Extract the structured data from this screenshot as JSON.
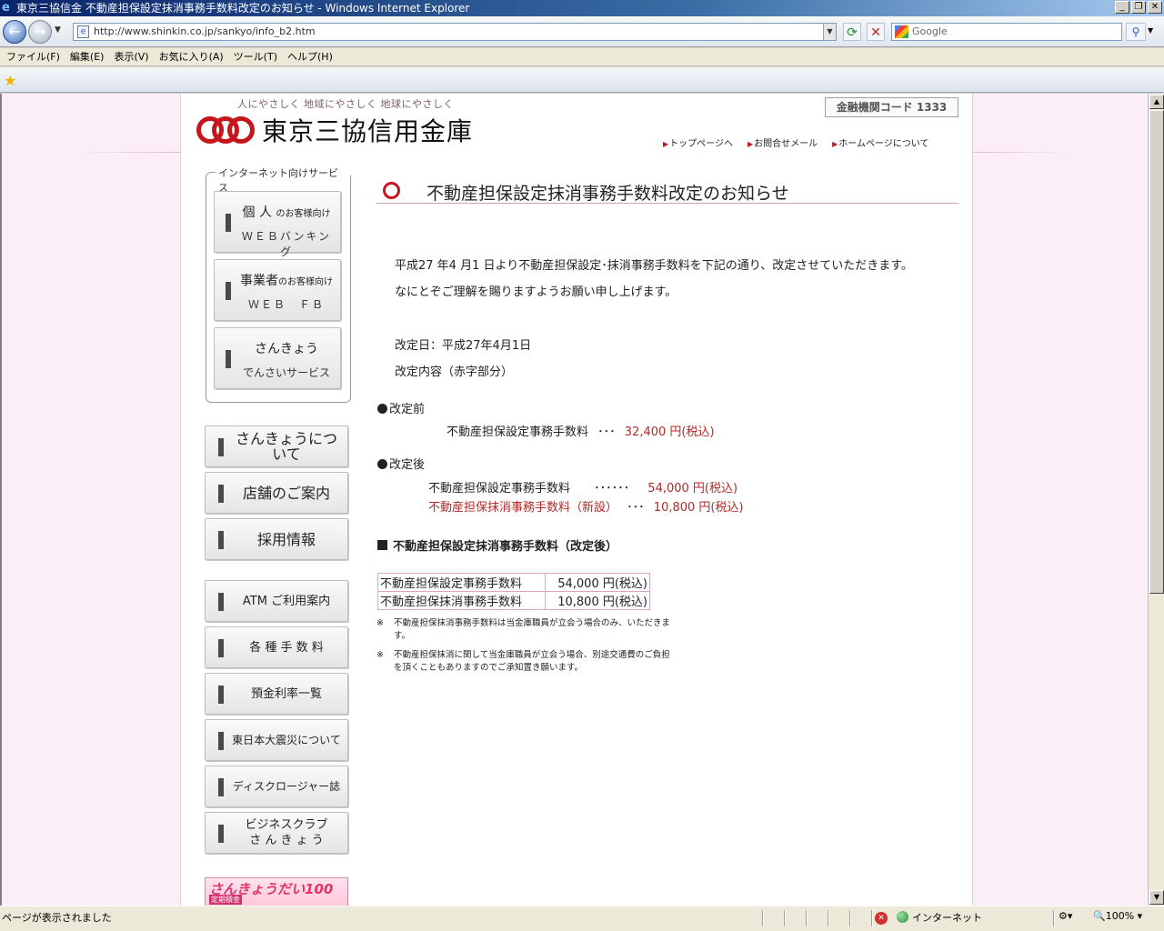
{
  "browser": {
    "title": "東京三協信金 不動産担保設定抹消事務手数料改定のお知らせ - Windows Internet Explorer",
    "url": "http://www.shinkin.co.jp/sankyo/info_b2.htm",
    "search_placeholder": "Google",
    "menu": [
      "ファイル(F)",
      "編集(E)",
      "表示(V)",
      "お気に入り(A)",
      "ツール(T)",
      "ヘルプ(H)"
    ],
    "status_message": "ページが表示されました",
    "zone": "インターネット",
    "zoom": "100%"
  },
  "header": {
    "tagline": "人にやさしく 地域にやさしく 地球にやさしく",
    "bank_name": "東京三協信用金庫",
    "institution_code": "金融機関コード 1333",
    "links": [
      "トップページへ",
      "お問合せメール",
      "ホームページについて"
    ]
  },
  "sidebar": {
    "service_legend": "インターネット向けサービス",
    "services": [
      {
        "line1": "個 人",
        "line1_small": "のお客様向け",
        "line2": "ＷＥＢバンキング"
      },
      {
        "line1": "事業者",
        "line1_small": "のお客様向け",
        "line2": "ＷＥＢ　ＦＢ"
      },
      {
        "line1": "さんきょう",
        "line1_small": "",
        "line2": "でんさいサービス"
      }
    ],
    "nav": [
      "さんきょうについて",
      "店舗のご案内",
      "採用情報",
      "ATM ご利用案内",
      "各 種 手 数 料",
      "預金利率一覧",
      "東日本大震災について",
      "ディスクロージャー誌",
      "ビジネスクラブ\nさ ん き ょ う"
    ],
    "banner_text": "さんきょうだい100",
    "banner_sub": "定期積金"
  },
  "main": {
    "title": "不動産担保設定抹消事務手数料改定のお知らせ",
    "intro1": "平成27 年4 月1 日より不動産担保設定･抹消事務手数料を下記の通り、改定させていただきます。",
    "intro2": "なにとぞご理解を賜りますようお願い申し上げます。",
    "revision_date": "改定日：平成27年4月1日",
    "revision_content": "改定内容（赤字部分）",
    "before_heading": "改定前",
    "before_item": "不動産担保設定事務手数料",
    "before_dots": "･･･",
    "before_value": "32,400 円(税込)",
    "after_heading": "改定後",
    "after_item1": "不動産担保設定事務手数料",
    "after_dots1": "･･････",
    "after_value1": "54,000 円(税込)",
    "after_item2": "不動産担保抹消事務手数料（新設）",
    "after_dots2": "･･･",
    "after_value2": "10,800 円(税込)",
    "table_title": "不動産担保設定抹消事務手数料（改定後）",
    "table": [
      {
        "name": "不動産担保設定事務手数料",
        "fee": "54,000 円(税込)"
      },
      {
        "name": "不動産担保抹消事務手数料",
        "fee": "10,800 円(税込)"
      }
    ],
    "note_mark": "※",
    "note1": "不動産担保抹消事務手数料は当金庫職員が立会う場合のみ、いただきます。",
    "note2": "不動産担保抹消に関して当金庫職員が立会う場合、別途交通費のご負担を頂くこともありますのでご承知置き願います。"
  }
}
